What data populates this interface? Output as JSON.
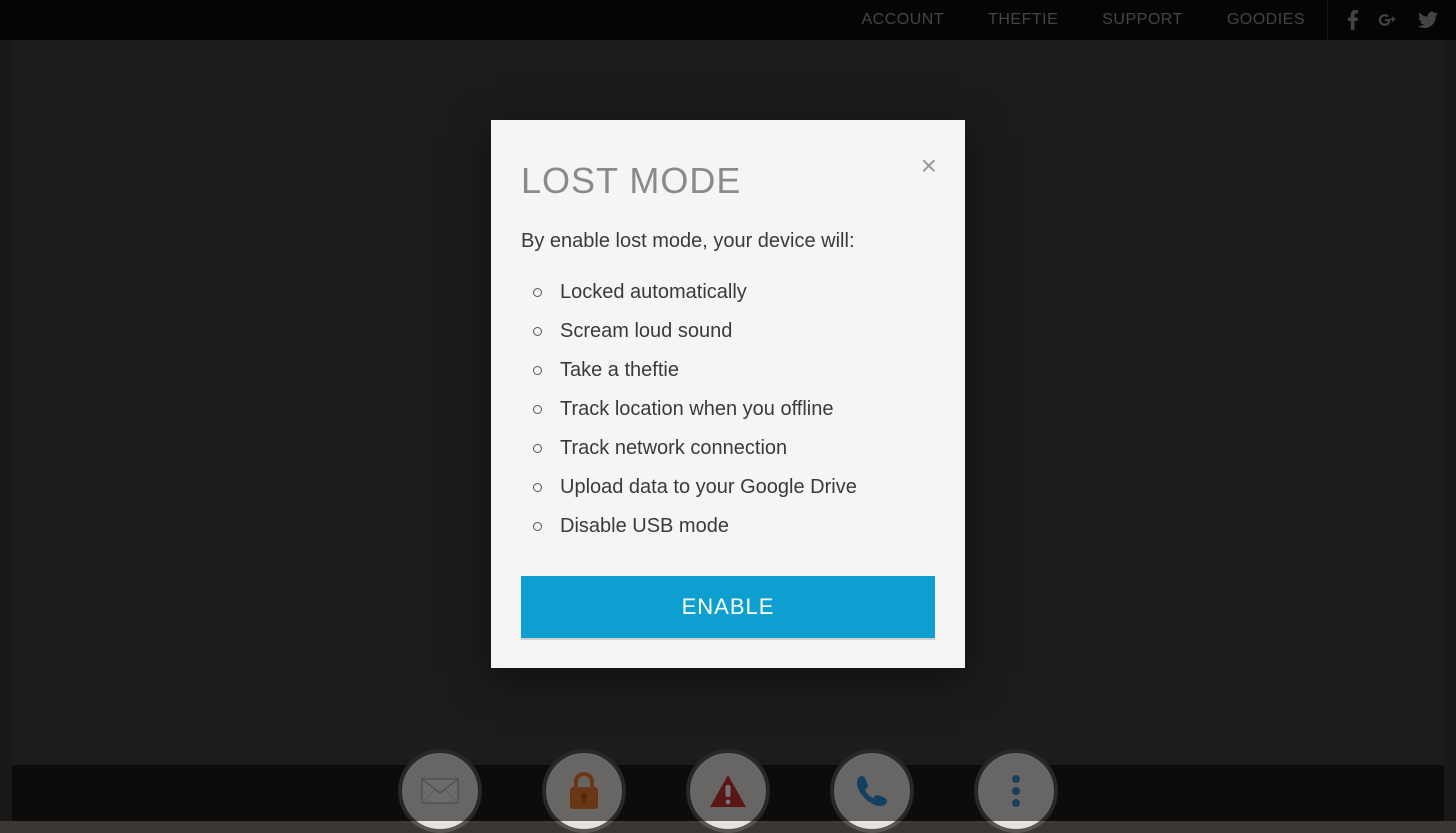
{
  "nav": {
    "links": [
      "ACCOUNT",
      "THEFTIE",
      "SUPPORT",
      "GOODIES"
    ]
  },
  "modal": {
    "title": "LOST MODE",
    "description": "By enable lost mode, your device will:",
    "items": [
      "Locked automatically",
      "Scream loud sound",
      "Take a theftie",
      "Track location when you offline",
      "Track network connection",
      "Upload data to your Google Drive",
      "Disable USB mode"
    ],
    "button_label": "ENABLE"
  }
}
